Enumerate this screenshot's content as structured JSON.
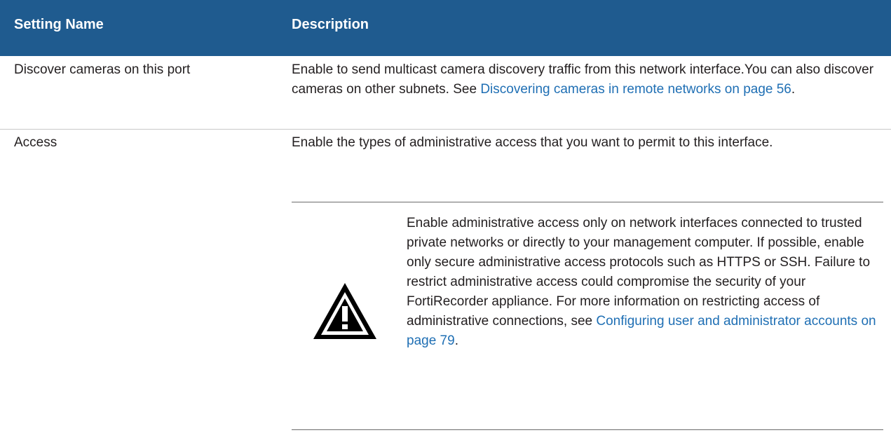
{
  "table": {
    "headers": [
      "Setting Name",
      "Description"
    ],
    "rows": [
      {
        "name": "Discover cameras on this port",
        "description": "Enable to send multicast camera discovery traffic from this network interface.You can also discover cameras on other subnets. See ",
        "link": "Discovering cameras in remote networks on page 56",
        "after": "."
      },
      {
        "name": "Access",
        "description": "Enable the types of administrative access that you want to permit to this interface.",
        "note": {
          "icon": "warning-icon",
          "text": "Enable administrative access only on network interfaces connected to trusted private networks or directly to your management computer. If possible, enable only secure administrative access protocols such as HTTPS or SSH. Failure to restrict administrative access could compromise the security of your FortiRecorder appliance. For more information on restricting access of administrative connections, see ",
          "link": "Configuring user and administrator accounts on page 79",
          "after": "."
        }
      }
    ]
  },
  "colors": {
    "header_bg": "#1f5b8f",
    "link": "#1f6fb4"
  }
}
